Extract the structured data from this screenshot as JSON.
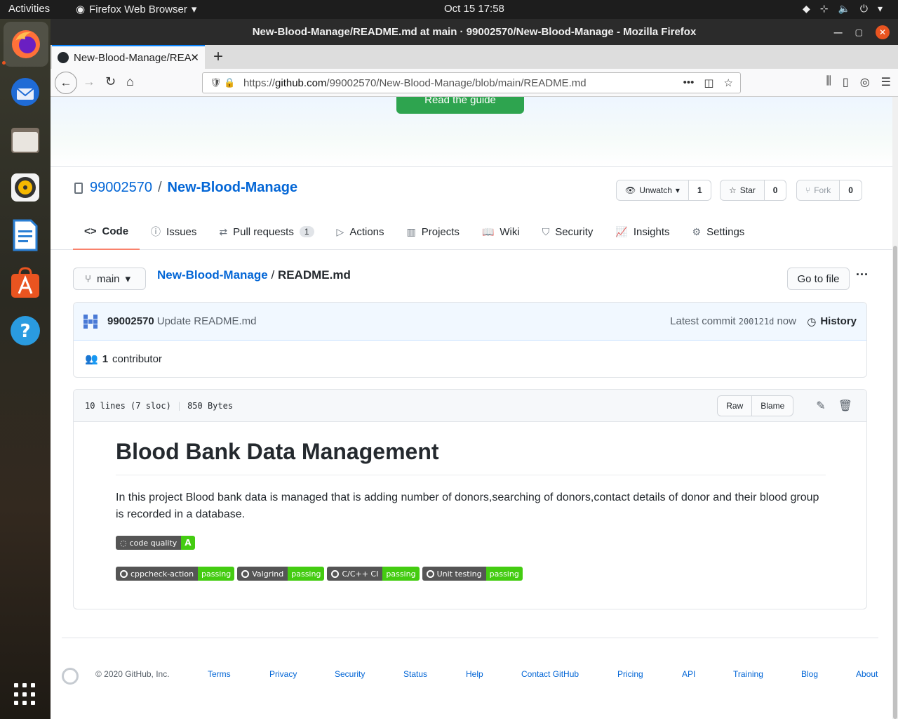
{
  "topbar": {
    "activities": "Activities",
    "app_name": "Firefox Web Browser",
    "clock": "Oct 15  17:58"
  },
  "window": {
    "title": "New-Blood-Manage/README.md at main · 99002570/New-Blood-Manage - Mozilla Firefox"
  },
  "tab": {
    "label": "New-Blood-Manage/REA"
  },
  "urlbar": {
    "prefix": "https://",
    "host": "github.com",
    "path": "/99002570/New-Blood-Manage/blob/main/README.md"
  },
  "banner": {
    "guide_button": "Read the guide"
  },
  "repo": {
    "owner": "99002570",
    "separator": "/",
    "name": "New-Blood-Manage",
    "watch_label": "Unwatch",
    "watch_count": "1",
    "star_label": "Star",
    "star_count": "0",
    "fork_label": "Fork",
    "fork_count": "0"
  },
  "nav": {
    "code": "Code",
    "issues": "Issues",
    "pulls": "Pull requests",
    "pulls_count": "1",
    "actions": "Actions",
    "projects": "Projects",
    "wiki": "Wiki",
    "security": "Security",
    "insights": "Insights",
    "settings": "Settings"
  },
  "filenav": {
    "branch": "main",
    "repo_link": "New-Blood-Manage",
    "separator": "/",
    "file": "README.md",
    "go_to_file": "Go to file",
    "more": "···"
  },
  "commit": {
    "author": "99002570",
    "message": "Update README.md",
    "latest_label": "Latest commit",
    "sha": "200121d",
    "when": "now",
    "history": "History",
    "contributors_count": "1",
    "contributors_label": "contributor"
  },
  "file": {
    "lines": "10 lines (7 sloc)",
    "size": "850 Bytes",
    "raw": "Raw",
    "blame": "Blame"
  },
  "readme": {
    "title": "Blood Bank Data Management",
    "description": "In this project Blood bank data is managed that is adding number of donors,searching of donors,contact details of donor and their blood group is recorded in a database.",
    "quality_badge": {
      "label": "code quality",
      "grade": "A"
    },
    "badges": [
      {
        "label": "cppcheck-action",
        "status": "passing"
      },
      {
        "label": "Valgrind",
        "status": "passing"
      },
      {
        "label": "C/C++ CI",
        "status": "passing"
      },
      {
        "label": "Unit testing",
        "status": "passing"
      }
    ]
  },
  "footer": {
    "copyright": "© 2020 GitHub, Inc.",
    "links": [
      "Terms",
      "Privacy",
      "Security",
      "Status",
      "Help",
      "Contact GitHub",
      "Pricing",
      "API",
      "Training",
      "Blog",
      "About"
    ]
  },
  "colors": {
    "accent_link": "#0366d6",
    "button_green": "#2ea44f",
    "badge_green": "#44cc11",
    "selected_tab_underline": "#f9826c"
  }
}
